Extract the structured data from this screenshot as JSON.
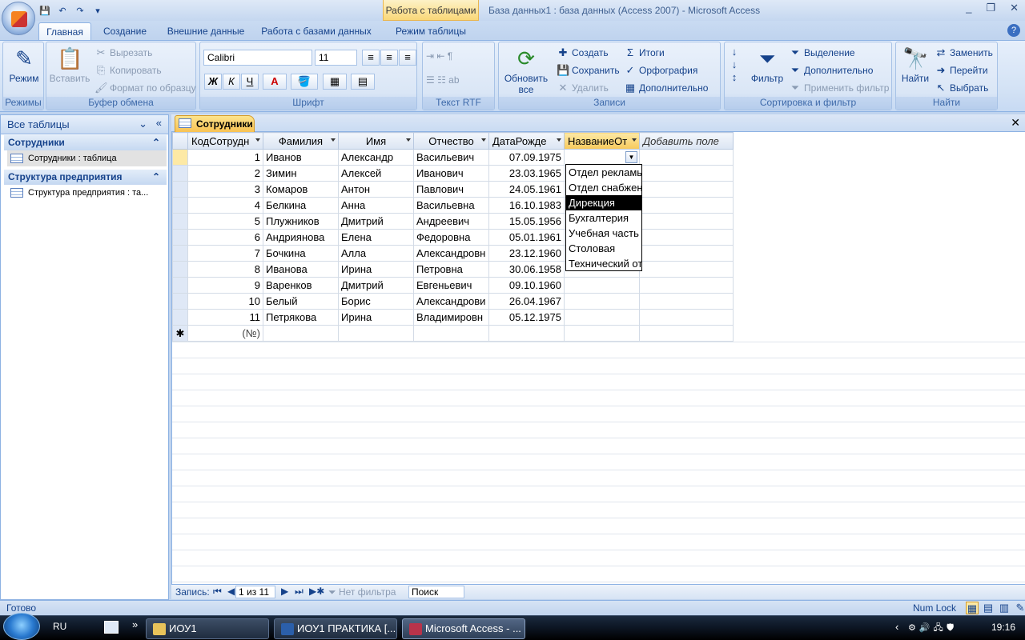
{
  "app": {
    "title": "База данных1 : база данных (Access 2007)  -  Microsoft Access",
    "context_tab": "Работа с таблицами",
    "window_buttons": [
      "_",
      "❐",
      "✕"
    ]
  },
  "tabs": [
    "Главная",
    "Создание",
    "Внешние данные",
    "Работа с базами данных",
    "Режим таблицы"
  ],
  "ribbon": {
    "modes": {
      "label": "Режимы",
      "view": "Режим"
    },
    "clipboard": {
      "label": "Буфер обмена",
      "paste": "Вставить",
      "cut": "Вырезать",
      "copy": "Копировать",
      "format_painter": "Формат по образцу"
    },
    "font": {
      "label": "Шрифт",
      "name": "Calibri",
      "size": "11",
      "bold": "Ж",
      "italic": "К",
      "underline": "Ч",
      "color": "A"
    },
    "rtf": {
      "label": "Текст RTF"
    },
    "records": {
      "label": "Записи",
      "refresh": "Обновить все",
      "new": "Создать",
      "save": "Сохранить",
      "delete": "Удалить",
      "totals": "Итоги",
      "spelling": "Орфография",
      "more": "Дополнительно"
    },
    "sort": {
      "label": "Сортировка и фильтр",
      "filter": "Фильтр",
      "selection": "Выделение",
      "advanced": "Дополнительно",
      "toggle": "Применить фильтр"
    },
    "find": {
      "label": "Найти",
      "find": "Найти",
      "replace": "Заменить",
      "goto": "Перейти",
      "select": "Выбрать"
    }
  },
  "nav": {
    "header": "Все таблицы",
    "groups": [
      {
        "name": "Сотрудники",
        "item": "Сотрудники : таблица"
      },
      {
        "name": "Структура предприятия",
        "item": "Структура предприятия : та..."
      }
    ]
  },
  "document": {
    "tab": "Сотрудники",
    "close": "✕"
  },
  "table": {
    "columns": [
      "КодСотрудн",
      "Фамилия",
      "Имя",
      "Отчество",
      "ДатаРожде",
      "НазваниеОт",
      "Добавить поле"
    ],
    "rows": [
      [
        "1",
        "Иванов",
        "Александр",
        "Васильевич",
        "07.09.1975",
        ""
      ],
      [
        "2",
        "Зимин",
        "Алексей",
        "Иванович",
        "23.03.1965",
        ""
      ],
      [
        "3",
        "Комаров",
        "Антон",
        "Павлович",
        "24.05.1961",
        ""
      ],
      [
        "4",
        "Белкина",
        "Анна",
        "Васильевна",
        "16.10.1983",
        ""
      ],
      [
        "5",
        "Плужников",
        "Дмитрий",
        "Андреевич",
        "15.05.1956",
        ""
      ],
      [
        "6",
        "Андриянова",
        "Елена",
        "Федоровна",
        "05.01.1961",
        ""
      ],
      [
        "7",
        "Бочкина",
        "Алла",
        "Александровн",
        "23.12.1960",
        ""
      ],
      [
        "8",
        "Иванова",
        "Ирина",
        "Петровна",
        "30.06.1958",
        ""
      ],
      [
        "9",
        "Варенков",
        "Дмитрий",
        "Евгеньевич",
        "09.10.1960",
        ""
      ],
      [
        "10",
        "Белый",
        "Борис",
        "Александрови",
        "26.04.1967",
        ""
      ],
      [
        "11",
        "Петрякова",
        "Ирина",
        "Владимировн",
        "05.12.1975",
        ""
      ]
    ],
    "new_row": "(№)",
    "new_row_marker": "✱"
  },
  "dropdown": {
    "items": [
      "Отдел рекламы",
      "Отдел снабжения",
      "Дирекция",
      "Бухгалтерия",
      "Учебная часть",
      "Столовая",
      "Технический отдел"
    ],
    "highlighted_index": 2
  },
  "record_nav": {
    "label": "Запись:",
    "position": "1 из 11",
    "filter": "Нет фильтра",
    "search": "Поиск"
  },
  "status": {
    "left": "Готово",
    "num_lock": "Num Lock"
  },
  "taskbar": {
    "lang": "RU",
    "buttons": [
      "ИОУ1",
      "ИОУ1 ПРАКТИКА [...",
      "Microsoft Access - ..."
    ],
    "clock": "19:16"
  }
}
